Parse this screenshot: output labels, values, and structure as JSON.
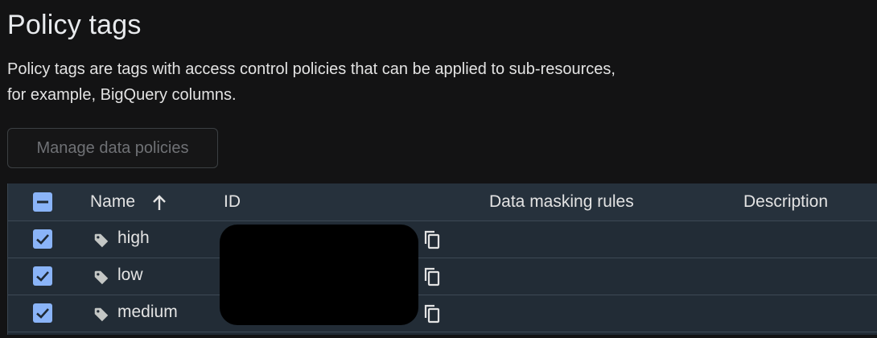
{
  "page": {
    "title": "Policy tags",
    "description": "Policy tags are tags with access control policies that can be applied to sub-resources, for example, BigQuery columns."
  },
  "actions": {
    "manage_label": "Manage data policies"
  },
  "table": {
    "columns": {
      "name": "Name",
      "id": "ID",
      "masking": "Data masking rules",
      "description": "Description"
    },
    "rows": [
      {
        "name": "high",
        "checked": true
      },
      {
        "name": "low",
        "checked": true
      },
      {
        "name": "medium",
        "checked": true
      }
    ]
  },
  "colors": {
    "accent": "#8ab4f8",
    "background": "#131314",
    "table_bg": "#222c36"
  },
  "icons": [
    "select-all-indeterminate-icon",
    "arrow-up-sort-icon",
    "tag-icon",
    "copy-icon",
    "checkbox-checked-icon"
  ]
}
